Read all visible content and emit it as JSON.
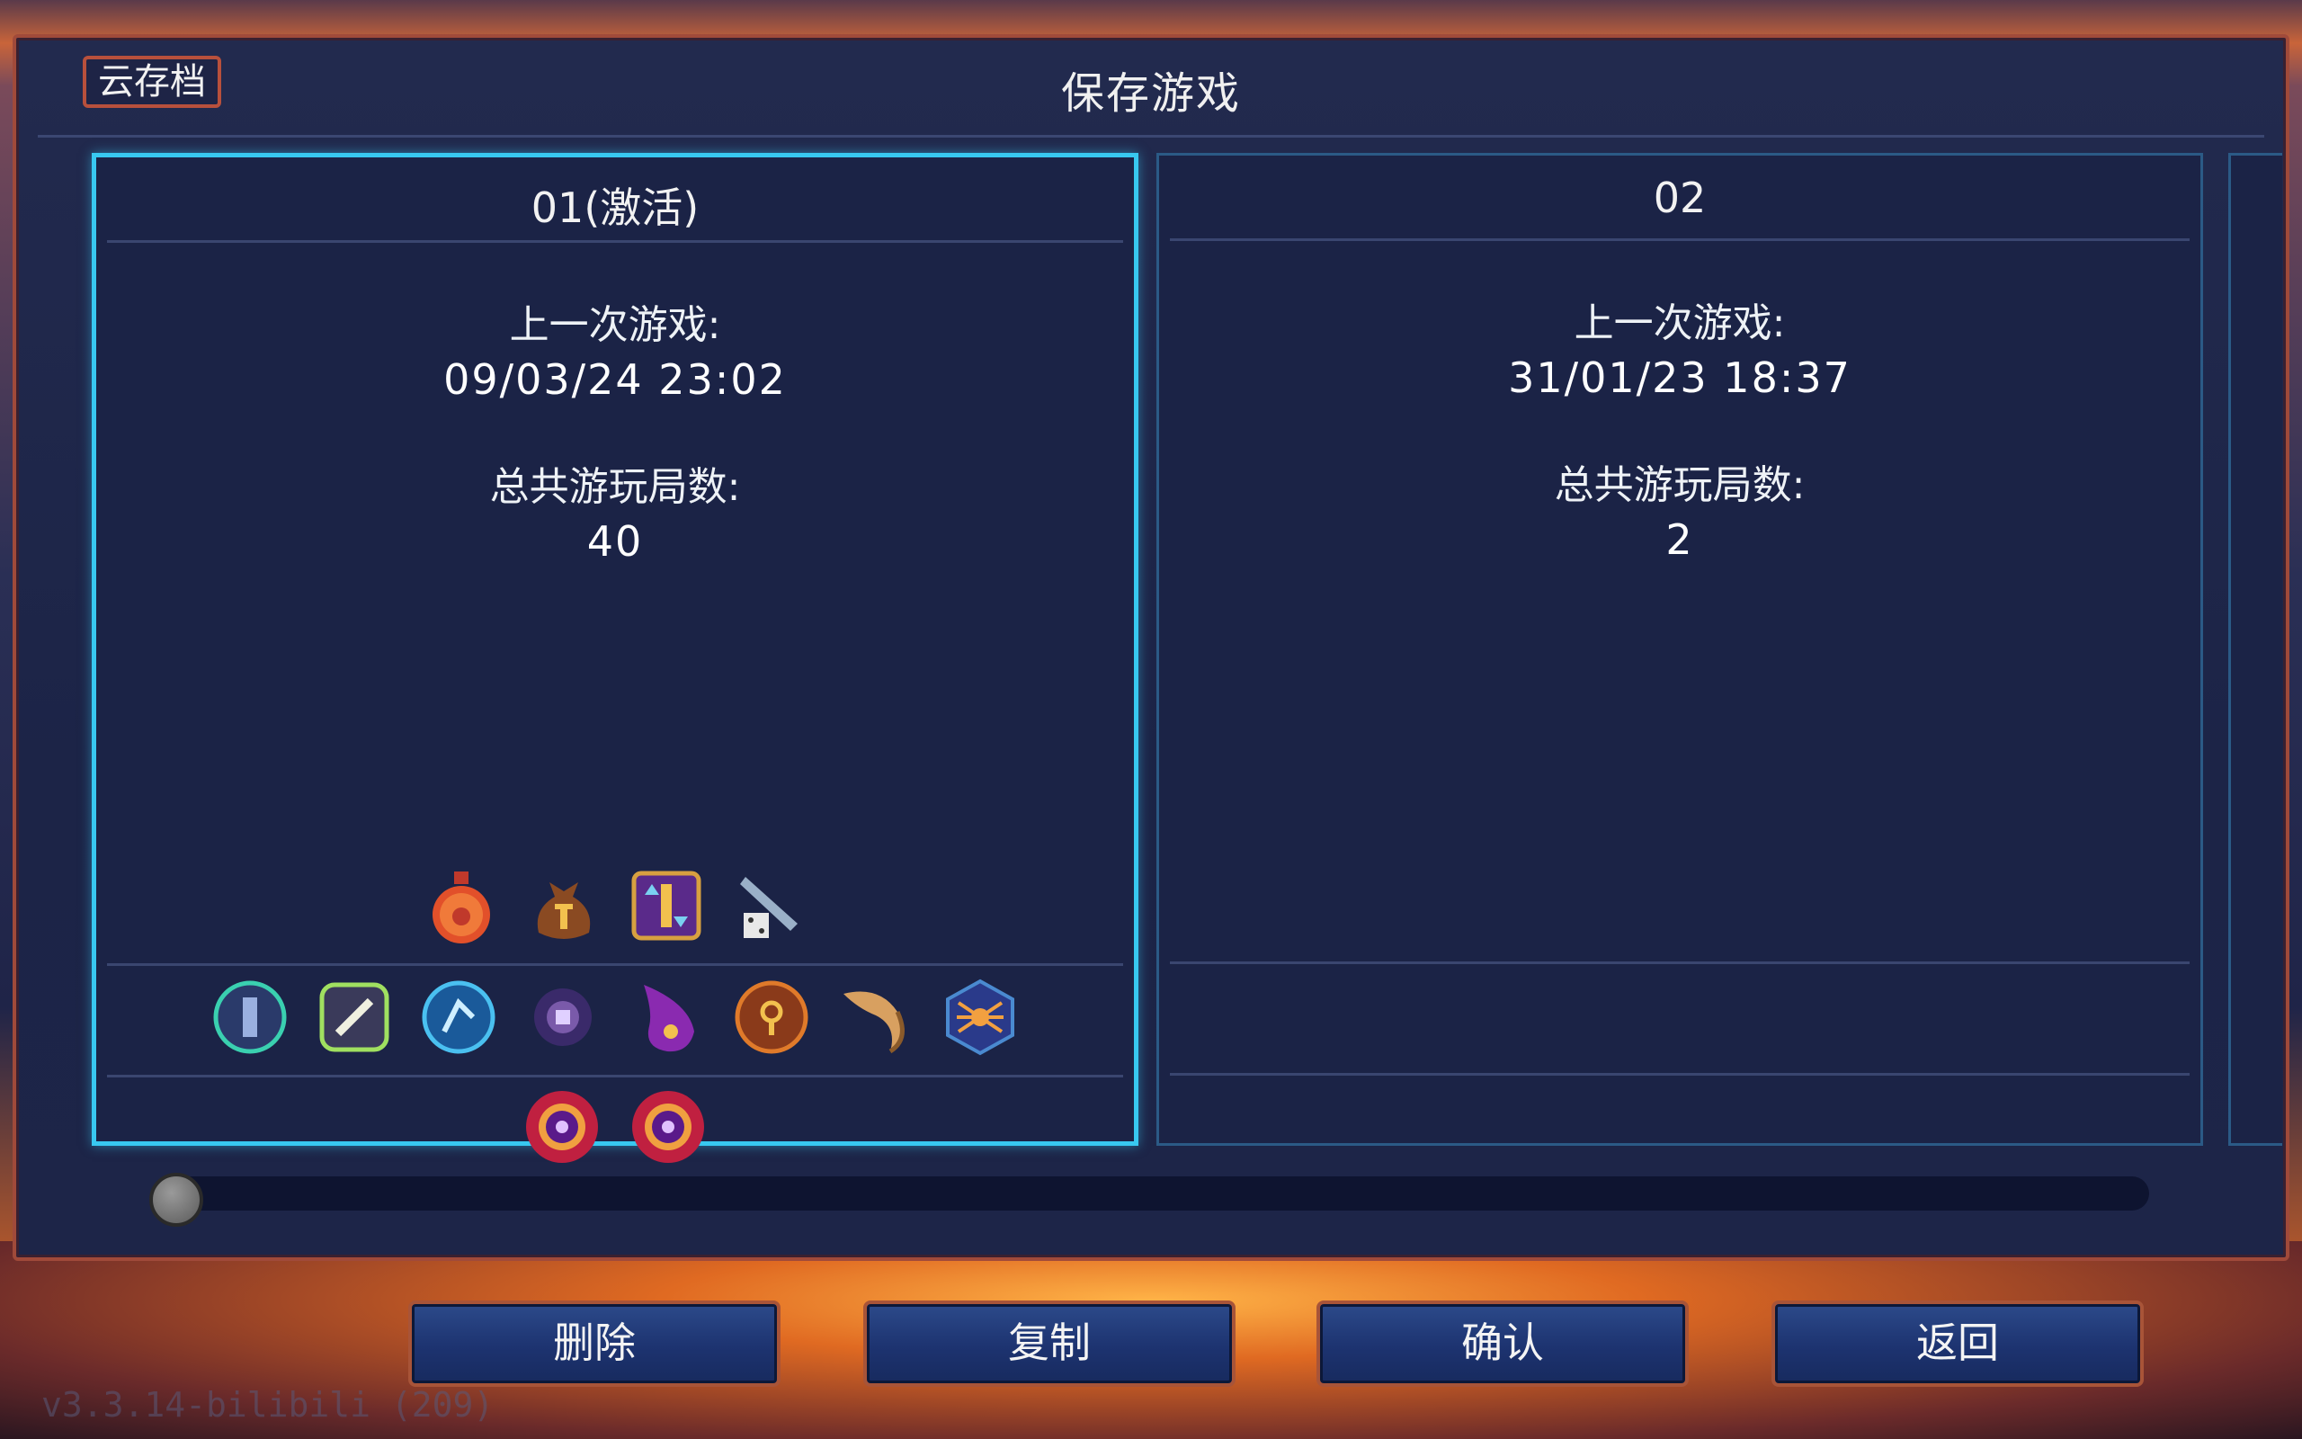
{
  "header": {
    "cloud_button": "云存档",
    "title": "保存游戏"
  },
  "slots": [
    {
      "title": "01(激活)",
      "last_played_label": "上一次游戏:",
      "last_played": "09/03/24 23:02",
      "runs_label": "总共游玩局数:",
      "runs": "40",
      "row1_icons": [
        "health-flask-icon",
        "gold-bag-icon",
        "swap-scroll-icon",
        "dice-blade-icon"
      ],
      "row2_icons": [
        "teal-rune-icon",
        "bone-rune-icon",
        "blue-rune-icon",
        "eye-orb-icon",
        "purple-flame-icon",
        "orange-rune-icon",
        "horn-icon",
        "spider-rune-icon"
      ],
      "row3_icons": [
        "boss-cell-icon",
        "boss-cell-icon"
      ]
    },
    {
      "title": "02",
      "last_played_label": "上一次游戏:",
      "last_played": "31/01/23 18:37",
      "runs_label": "总共游玩局数:",
      "runs": "2"
    }
  ],
  "footer_buttons": {
    "delete": "删除",
    "copy": "复制",
    "confirm": "确认",
    "back": "返回"
  },
  "version": "v3.3.14-bilibili (209)",
  "colors": {
    "active_border": "#38c8f0",
    "panel_border": "#a04a3a"
  }
}
